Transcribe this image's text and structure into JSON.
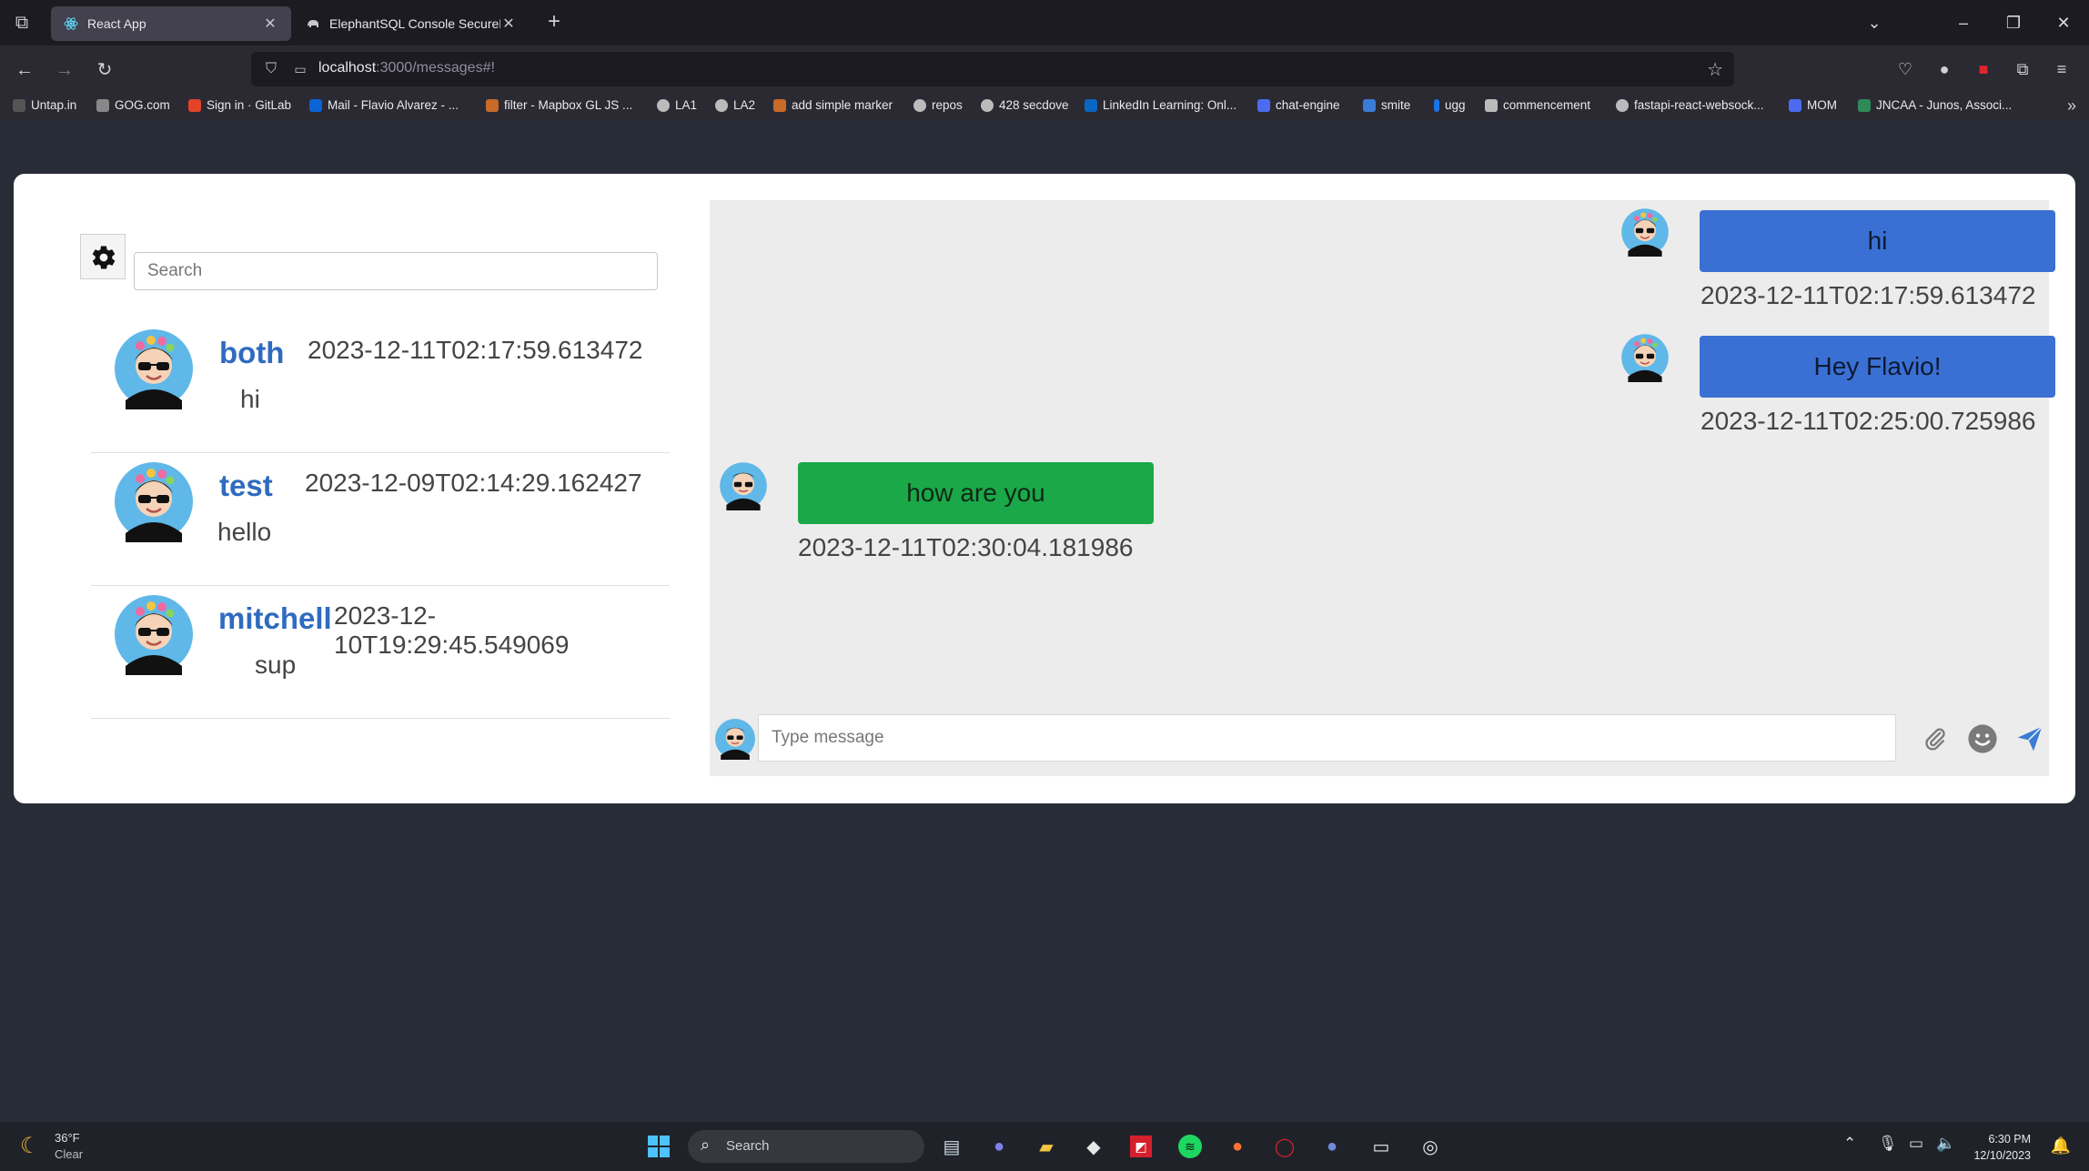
{
  "browser": {
    "tabs": [
      {
        "title": "React App",
        "active": true
      },
      {
        "title": "ElephantSQL Console SecureDc",
        "active": false
      }
    ],
    "url": {
      "host": "localhost",
      "rest": ":3000/messages#!"
    },
    "bookmarks": [
      "Untap.in",
      "GOG.com",
      "Sign in · GitLab",
      "Mail - Flavio Alvarez - ...",
      "filter - Mapbox GL JS ...",
      "LA1",
      "LA2",
      "add simple marker",
      "repos",
      "428 secdove",
      "LinkedIn Learning: Onl...",
      "chat-engine",
      "smite",
      "ugg",
      "commencement",
      "fastapi-react-websock...",
      "MOM",
      "JNCAA - Junos, Associ..."
    ]
  },
  "sidebar": {
    "search_placeholder": "Search",
    "conversations": [
      {
        "name": "both",
        "time": "2023-12-11T02:17:59.613472",
        "last": "hi"
      },
      {
        "name": "test",
        "time": "2023-12-09T02:14:29.162427",
        "last": "hello"
      },
      {
        "name": "mitchell",
        "time": "2023-12-10T19:29:45.549069",
        "last": "sup"
      }
    ]
  },
  "messages": [
    {
      "text": "hi",
      "time": "2023-12-11T02:17:59.613472",
      "dir": "out"
    },
    {
      "text": "Hey Flavio!",
      "time": "2023-12-11T02:25:00.725986",
      "dir": "out"
    },
    {
      "text": "how are you",
      "time": "2023-12-11T02:30:04.181986",
      "dir": "in"
    }
  ],
  "composer": {
    "placeholder": "Type message"
  },
  "taskbar": {
    "temp": "36°F",
    "weather": "Clear",
    "search_label": "Search",
    "time": "6:30 PM",
    "date": "12/10/2023"
  },
  "colors": {
    "out_bubble": "#3a70d4",
    "in_bubble": "#1aa848",
    "name_link": "#2f6bbf"
  }
}
